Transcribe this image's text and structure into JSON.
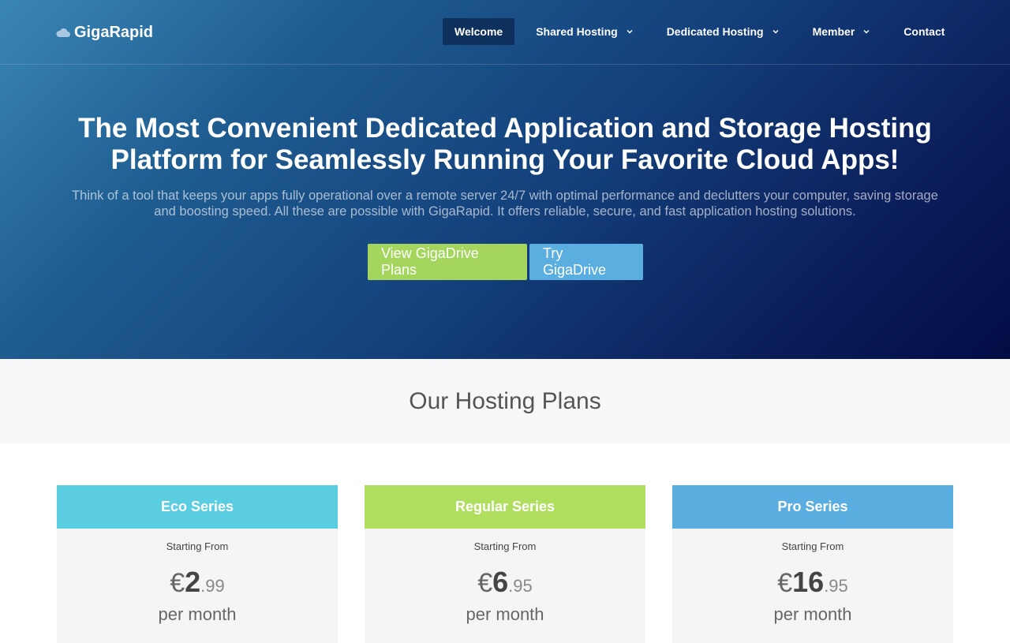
{
  "brand": {
    "name": "GigaRapid",
    "icon": "cloud-icon"
  },
  "nav": {
    "items": [
      {
        "label": "Welcome",
        "active": true,
        "dropdown": false
      },
      {
        "label": "Shared Hosting",
        "active": false,
        "dropdown": true
      },
      {
        "label": "Dedicated Hosting",
        "active": false,
        "dropdown": true
      },
      {
        "label": "Member",
        "active": false,
        "dropdown": true
      },
      {
        "label": "Contact",
        "active": false,
        "dropdown": false
      }
    ]
  },
  "hero": {
    "title": "The Most Convenient Dedicated Application and Storage Hosting Platform for Seamlessly Running Your Favorite Cloud Apps!",
    "subtitle": "Think of a tool that keeps your apps fully operational over a remote server 24/7 with optimal performance and declutters your computer, saving storage and boosting speed. All these are possible with GigaRapid. It offers reliable, secure, and fast application hosting solutions.",
    "primary_button": "View GigaDrive Plans",
    "secondary_button": "Try GigaDrive"
  },
  "plans": {
    "heading": "Our Hosting Plans",
    "items": [
      {
        "name": "Eco Series",
        "starting_label": "Starting From",
        "currency": "€",
        "price_major": "2",
        "price_minor": ".99",
        "period": "per month",
        "color": "#5bcde0"
      },
      {
        "name": "Regular Series",
        "starting_label": "Starting From",
        "currency": "€",
        "price_major": "6",
        "price_minor": ".95",
        "period": "per month",
        "color": "#b0df5f"
      },
      {
        "name": "Pro Series",
        "starting_label": "Starting From",
        "currency": "€",
        "price_major": "16",
        "price_minor": ".95",
        "period": "per month",
        "color": "#5aaedf"
      }
    ]
  },
  "colors": {
    "hero_gradient_start": "#3a86b6",
    "hero_gradient_end": "#020c45",
    "button_green": "#a4d65e",
    "button_blue": "#5aafe0"
  }
}
